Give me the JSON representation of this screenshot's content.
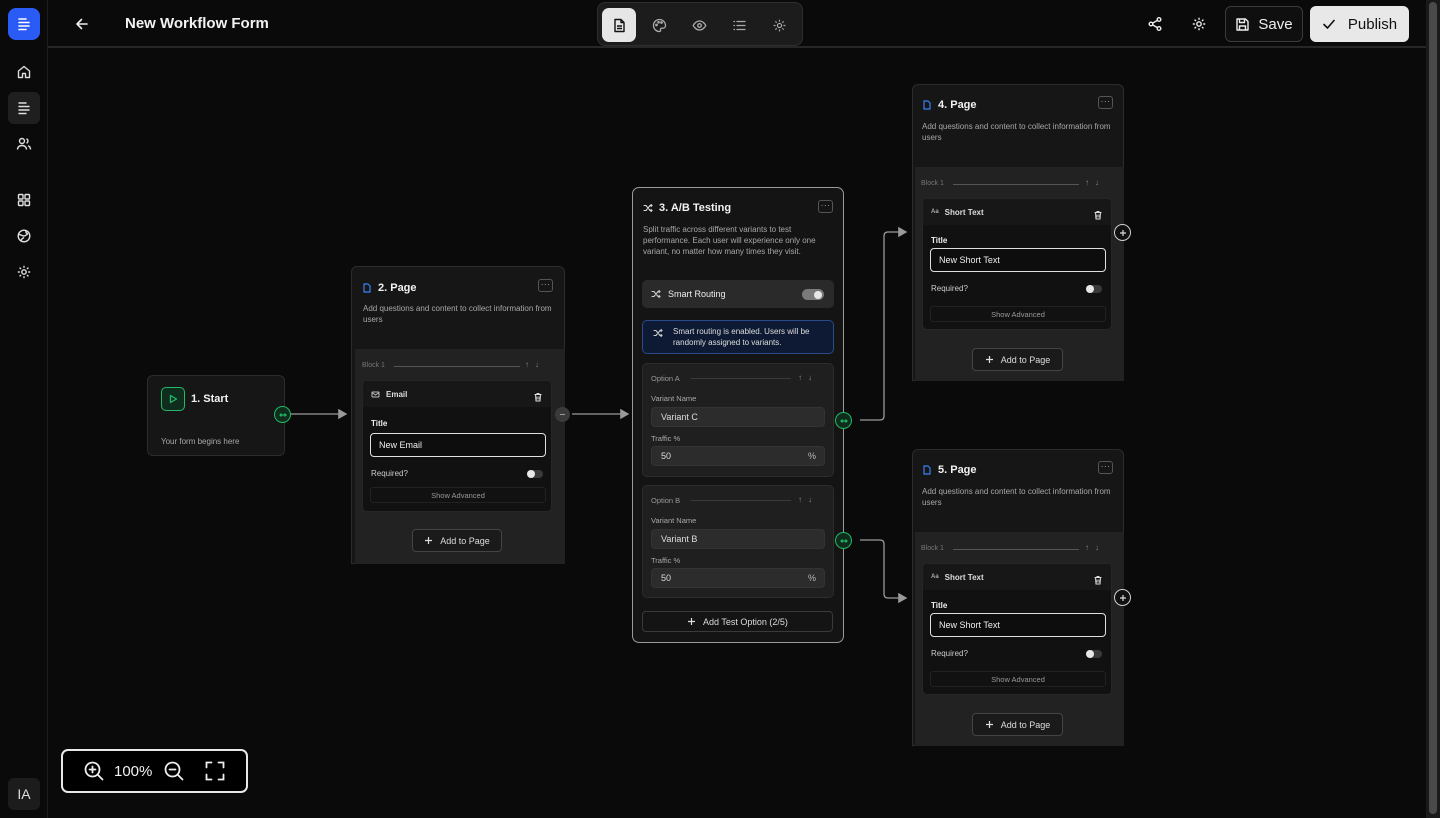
{
  "app": {
    "title": "New Workflow Form",
    "avatar_initials": "IA",
    "accent_color": "#2a5bf5",
    "success_color": "#22b868"
  },
  "sidebar": {
    "items": [
      {
        "icon": "home-icon"
      },
      {
        "icon": "forms-icon",
        "active": true
      },
      {
        "icon": "users-icon"
      },
      {
        "icon": "grid-icon"
      },
      {
        "icon": "globe-icon"
      },
      {
        "icon": "gear-icon"
      }
    ]
  },
  "toolbar": {
    "modes": [
      "document-icon",
      "palette-icon",
      "eye-icon",
      "list-icon",
      "gear-icon"
    ],
    "active_mode": "document-icon",
    "save_label": "Save",
    "publish_label": "Publish"
  },
  "nodes": {
    "start": {
      "title": "1. Start",
      "desc": "Your form begins here"
    },
    "page2": {
      "title": "2. Page",
      "desc": "Add questions and content to collect information from users",
      "block_label": "Block 1",
      "field_type": "Email",
      "title_label": "Title",
      "title_value": "New Email",
      "required_label": "Required?",
      "show_advanced": "Show Advanced",
      "add_label": "Add to Page"
    },
    "ab": {
      "title": "3. A/B Testing",
      "desc": "Split traffic across different variants to test performance. Each user will experience only one variant, no matter how many times they visit.",
      "smart_label": "Smart Routing",
      "smart_enabled": true,
      "smart_info": "Smart routing is enabled. Users will be randomly assigned to variants.",
      "options": [
        {
          "label": "Option A",
          "variant_label": "Variant Name",
          "variant": "Variant C",
          "traffic_label": "Traffic %",
          "traffic": "50",
          "unit": "%"
        },
        {
          "label": "Option B",
          "variant_label": "Variant Name",
          "variant": "Variant B",
          "traffic_label": "Traffic %",
          "traffic": "50",
          "unit": "%"
        }
      ],
      "add_option": "Add Test Option (2/5)"
    },
    "page4": {
      "title": "4. Page",
      "desc": "Add questions and content to collect information from users",
      "block_label": "Block 1",
      "field_type": "Short Text",
      "title_label": "Title",
      "title_value": "New Short Text",
      "required_label": "Required?",
      "show_advanced": "Show Advanced",
      "add_label": "Add to Page"
    },
    "page5": {
      "title": "5. Page",
      "desc": "Add questions and content to collect information from users",
      "block_label": "Block 1",
      "field_type": "Short Text",
      "title_label": "Title",
      "title_value": "New Short Text",
      "required_label": "Required?",
      "show_advanced": "Show Advanced",
      "add_label": "Add to Page"
    }
  },
  "zoom": {
    "level": "100%"
  }
}
